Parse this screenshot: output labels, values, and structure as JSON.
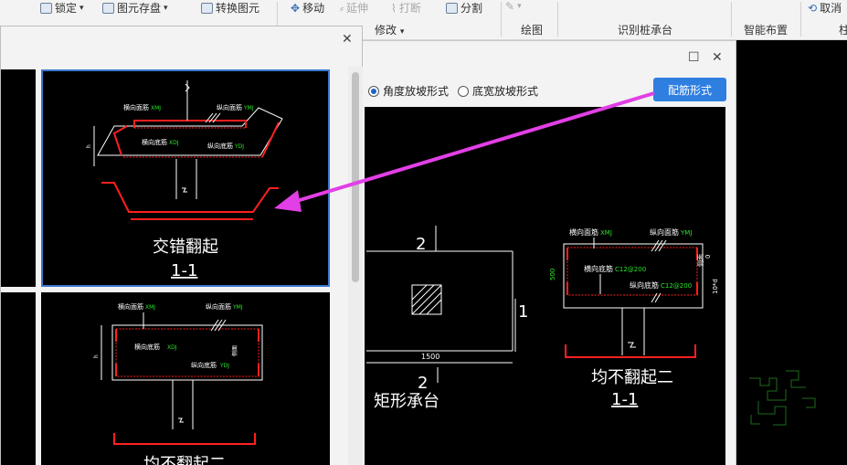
{
  "ribbon": {
    "lock": "锁定",
    "save_element": "图元存盘",
    "convert_element": "转换图元",
    "move": "移动",
    "extend": "延伸",
    "break": "打断",
    "split": "分割",
    "modify_group": "修改",
    "draw_group": "绘图",
    "identify_group": "识别桩承台",
    "smart_layout_group": "智能布置",
    "cancel": "取消"
  },
  "back_dialog": {
    "slope_options": [
      "角度放坡形式",
      "底宽放坡形式"
    ],
    "selected_slope": "角度放坡形式",
    "rebar_button": "配筋形式",
    "plan_label_top": "2",
    "plan_label_right": "1",
    "plan_label_bottom": "2",
    "plan_dim": "1500",
    "plan_caption": "矩形承台",
    "section": {
      "top_rebar": "横向面筋",
      "top_rebar_code": "XMJ",
      "long_top": "纵向面筋",
      "long_top_code": "YMJ",
      "bottom_rebar": "横向底筋",
      "bottom_rebar_spec": "C12@200",
      "long_bottom": "纵向底筋",
      "long_bottom_spec": "C12@200",
      "height": "500",
      "cover": "0",
      "side": "侧面",
      "side2": "10*d",
      "caption": "均不翻起二",
      "section_no": "1-1"
    }
  },
  "front_dialog": {
    "tile_a": {
      "top_rebar": "横向面筋",
      "top_rebar_code": "XMJ",
      "long_top": "纵向面筋",
      "long_top_code": "YMJ",
      "bottom_rebar": "横向底筋",
      "bottom_rebar_code": "XDJ",
      "long_bottom": "纵向底筋",
      "long_bottom_code": "YDJ",
      "caption": "交错翻起",
      "section_no": "1-1"
    },
    "tile_b": {
      "top_rebar": "横向面筋",
      "top_rebar_code": "XMJ",
      "long_top": "纵向面筋",
      "long_top_code": "YMJ",
      "bottom_rebar": "横向底筋",
      "bottom_rebar_code": "XDJ",
      "long_bottom": "纵向底筋",
      "long_bottom_code": "YDJ",
      "side": "侧面",
      "caption": "均不翻起二"
    }
  },
  "colors": {
    "accent": "#2f7fe0",
    "arrow": "#e23fe6",
    "rebar": "#ff2020",
    "label_code": "#29e629",
    "selection": "#3b78d0"
  }
}
